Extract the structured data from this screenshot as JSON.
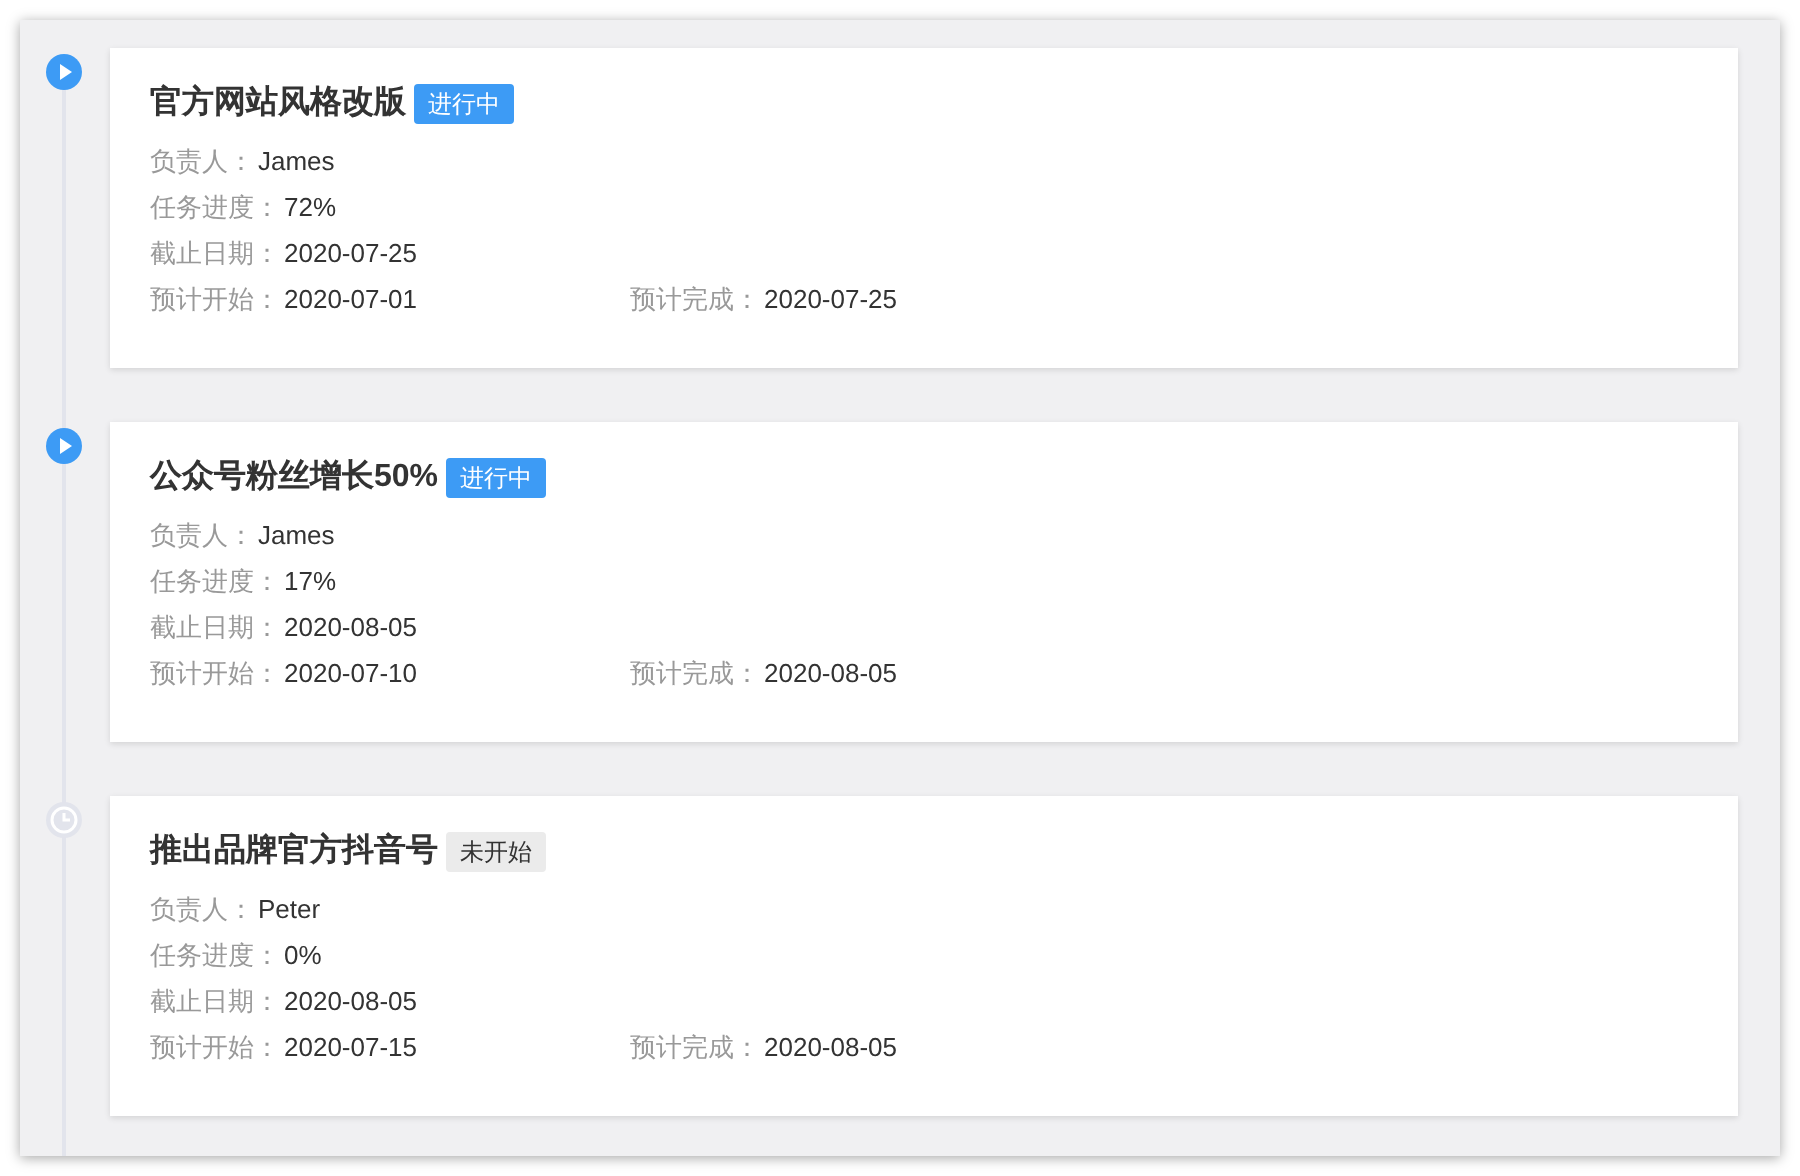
{
  "tasks": [
    {
      "title": "官方网站风格改版",
      "status": {
        "kind": "in_progress",
        "label": "进行中"
      },
      "rows": [
        [
          {
            "label": "负责人：",
            "value": "James"
          }
        ],
        [
          {
            "label": "任务进度：",
            "value": "72%"
          }
        ],
        [
          {
            "label": "截止日期：",
            "value": "2020-07-25"
          }
        ],
        [
          {
            "label": "预计开始：",
            "value": "2020-07-01"
          },
          {
            "label": "预计完成：",
            "value": "2020-07-25"
          }
        ]
      ]
    },
    {
      "title": "公众号粉丝增长50%",
      "status": {
        "kind": "in_progress",
        "label": "进行中"
      },
      "rows": [
        [
          {
            "label": "负责人：",
            "value": "James"
          }
        ],
        [
          {
            "label": "任务进度：",
            "value": "17%"
          }
        ],
        [
          {
            "label": "截止日期：",
            "value": "2020-08-05"
          }
        ],
        [
          {
            "label": "预计开始：",
            "value": "2020-07-10"
          },
          {
            "label": "预计完成：",
            "value": "2020-08-05"
          }
        ]
      ]
    },
    {
      "title": "推出品牌官方抖音号",
      "status": {
        "kind": "not_started",
        "label": "未开始"
      },
      "rows": [
        [
          {
            "label": "负责人：",
            "value": "Peter"
          }
        ],
        [
          {
            "label": "任务进度：",
            "value": "0%"
          }
        ],
        [
          {
            "label": "截止日期：",
            "value": "2020-08-05"
          }
        ],
        [
          {
            "label": "预计开始：",
            "value": "2020-07-15"
          },
          {
            "label": "预计完成：",
            "value": "2020-08-05"
          }
        ]
      ]
    }
  ]
}
